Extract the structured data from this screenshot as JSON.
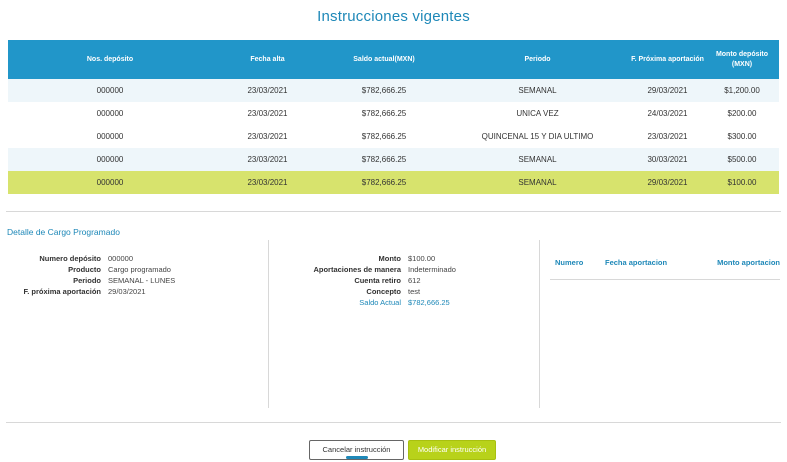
{
  "page_title": "Instrucciones vigentes",
  "table": {
    "headers": [
      "Nos. depósito",
      "Fecha alta",
      "Saldo actual(MXN)",
      "Periodo",
      "F. Próxima aportación",
      "Monto depósito (MXN)"
    ],
    "rows": [
      [
        "000000",
        "23/03/2021",
        "$782,666.25",
        "SEMANAL",
        "29/03/2021",
        "$1,200.00"
      ],
      [
        "000000",
        "23/03/2021",
        "$782,666.25",
        "UNICA VEZ",
        "24/03/2021",
        "$200.00"
      ],
      [
        "000000",
        "23/03/2021",
        "$782,666.25",
        "QUINCENAL 15 Y DIA ULTIMO",
        "23/03/2021",
        "$300.00"
      ],
      [
        "000000",
        "23/03/2021",
        "$782,666.25",
        "SEMANAL",
        "30/03/2021",
        "$500.00"
      ],
      [
        "000000",
        "23/03/2021",
        "$782,666.25",
        "SEMANAL",
        "29/03/2021",
        "$100.00"
      ]
    ],
    "selected_row": 4
  },
  "detail": {
    "title": "Detalle de Cargo Programado",
    "left": [
      {
        "label": "Numero depósito",
        "value": "000000"
      },
      {
        "label": "Producto",
        "value": "Cargo programado"
      },
      {
        "label": "Periodo",
        "value": "SEMANAL - LUNES"
      },
      {
        "label": "F. próxima aportación",
        "value": "29/03/2021"
      }
    ],
    "middle": [
      {
        "label": "Monto",
        "value": "$100.00"
      },
      {
        "label": "Aportaciones de manera",
        "value": "Indeterminado"
      },
      {
        "label": "Cuenta retiro",
        "value": "612"
      },
      {
        "label": "Concepto",
        "value": "test"
      },
      {
        "label": "Saldo Actual",
        "value": "$782,666.25"
      }
    ],
    "sub_table_headers": [
      "Numero",
      "Fecha aportacion",
      "Monto aportacion"
    ]
  },
  "buttons": {
    "cancel": "Cancelar instrucción",
    "modify": "Modificar instrucción"
  },
  "colors": {
    "accent": "#2196c9",
    "link": "#1e88b8",
    "selected_row": "#d7e36d",
    "primary_button": "#b8d21a"
  }
}
